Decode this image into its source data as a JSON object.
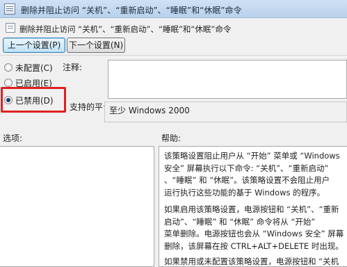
{
  "window": {
    "title": "删除并阻止访问 “关机”、“重新启动”、“睡眠”和“休眠”命令"
  },
  "header": {
    "setting_title": "删除并阻止访问 “关机”、“重新启动”、“睡眠”和“休眠”命令"
  },
  "nav": {
    "prev_label": "上一个设置(P)",
    "next_label": "下一个设置(N)"
  },
  "state": {
    "options": [
      {
        "label": "未配置(C)",
        "checked": false
      },
      {
        "label": "已启用(E)",
        "checked": false
      },
      {
        "label": "已禁用(D)",
        "checked": true
      }
    ]
  },
  "comment": {
    "label": "注释:",
    "value": ""
  },
  "platform": {
    "label": "支持的平台:",
    "value": "至少 Windows 2000"
  },
  "options_pane": {
    "label": "选项:"
  },
  "help": {
    "label": "帮助:",
    "paragraph1": [
      "该策略设置阻止用户从 “开始” 菜单或 “Windows",
      "安全” 屏幕执行以下命令: “关机”、“重新启动”",
      "、“睡眠” 和 “休眠”。该策略设置不会阻止用户",
      "运行执行这些功能的基于 Windows 的程序。"
    ],
    "paragraph2": [
      "如果启用该策略设置，电源按钮和 “关机”、“重新",
      "启动”、“睡眠” 和 “休眠” 命令将从 “开始”",
      "菜单删除。电源按钮也会从 “Windows 安全” 屏幕",
      "删除，该屏幕在按 CTRL+ALT+DELETE 时出现。"
    ],
    "paragraph3": [
      "如果禁用或未配置该策略设置，电源按钮和 “关机"
    ]
  },
  "colors": {
    "highlight": "#e02020",
    "titlebar": "#c4daf2",
    "accent_button": "#3c7fb1"
  },
  "icons": [
    "app-icon",
    "setting-icon"
  ]
}
